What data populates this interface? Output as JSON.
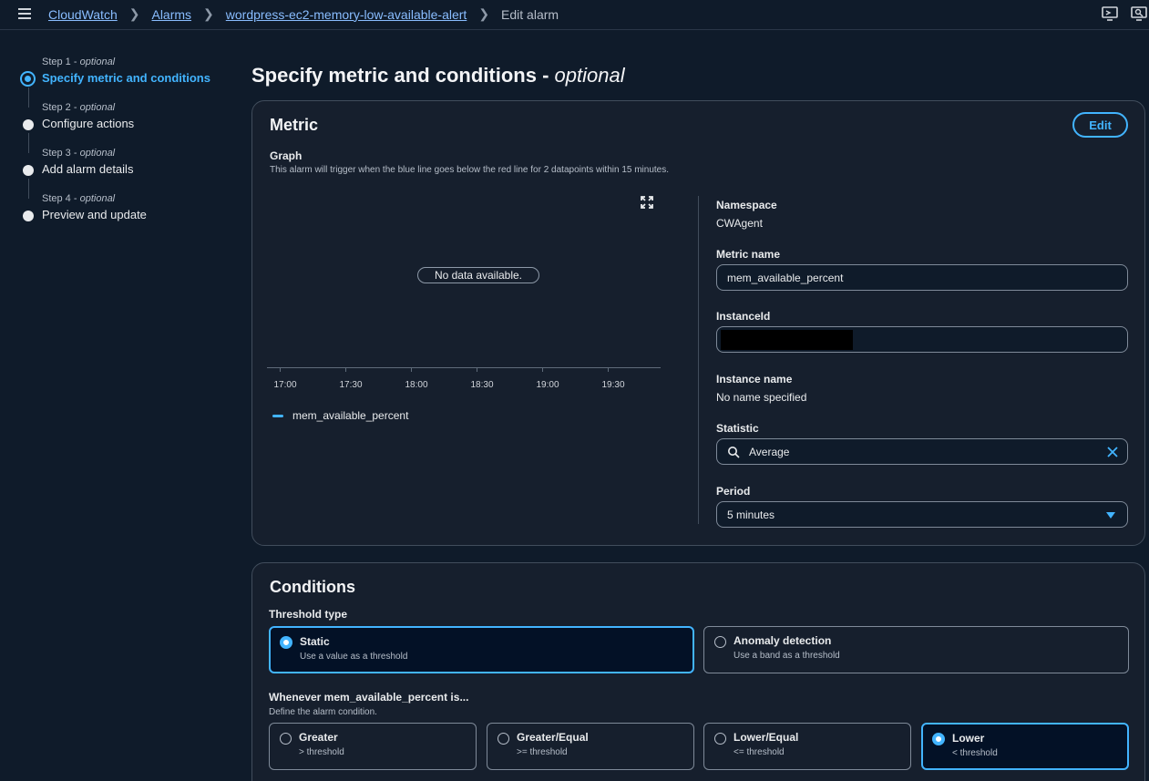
{
  "breadcrumbs": {
    "items": [
      "CloudWatch",
      "Alarms",
      "wordpress-ec2-memory-low-available-alert"
    ],
    "current": "Edit alarm"
  },
  "steps": [
    {
      "sub": "Step 1",
      "optional": "optional",
      "title": "Specify metric and conditions",
      "active": true
    },
    {
      "sub": "Step 2",
      "optional": "optional",
      "title": "Configure actions",
      "active": false
    },
    {
      "sub": "Step 3",
      "optional": "optional",
      "title": "Add alarm details",
      "active": false
    },
    {
      "sub": "Step 4",
      "optional": "optional",
      "title": "Preview and update",
      "active": false
    }
  ],
  "page": {
    "title": "Specify metric and conditions - ",
    "title_optional": "optional"
  },
  "metric": {
    "heading": "Metric",
    "edit_label": "Edit",
    "graph_label": "Graph",
    "graph_desc": "This alarm will trigger when the blue line goes below the red line for 2 datapoints within 15 minutes.",
    "no_data": "No data available.",
    "x_ticks": [
      "17:00",
      "17:30",
      "18:00",
      "18:30",
      "19:00",
      "19:30"
    ],
    "legend": "mem_available_percent",
    "namespace_label": "Namespace",
    "namespace_value": "CWAgent",
    "metric_name_label": "Metric name",
    "metric_name_value": "mem_available_percent",
    "instanceid_label": "InstanceId",
    "instance_name_label": "Instance name",
    "instance_name_value": "No name specified",
    "statistic_label": "Statistic",
    "statistic_value": "Average",
    "period_label": "Period",
    "period_value": "5 minutes"
  },
  "conditions": {
    "heading": "Conditions",
    "threshold_type_label": "Threshold type",
    "threshold_types": [
      {
        "title": "Static",
        "desc": "Use a value as a threshold",
        "selected": true
      },
      {
        "title": "Anomaly detection",
        "desc": "Use a band as a threshold",
        "selected": false
      }
    ],
    "whenever_label": "Whenever mem_available_percent is...",
    "whenever_desc": "Define the alarm condition.",
    "comparisons": [
      {
        "title": "Greater",
        "desc": "> threshold",
        "selected": false
      },
      {
        "title": "Greater/Equal",
        "desc": ">= threshold",
        "selected": false
      },
      {
        "title": "Lower/Equal",
        "desc": "<= threshold",
        "selected": false
      },
      {
        "title": "Lower",
        "desc": "< threshold",
        "selected": true
      }
    ]
  },
  "colors": {
    "accent": "#42b4ff",
    "background": "#0f1b2a",
    "panel": "#161f2d"
  }
}
